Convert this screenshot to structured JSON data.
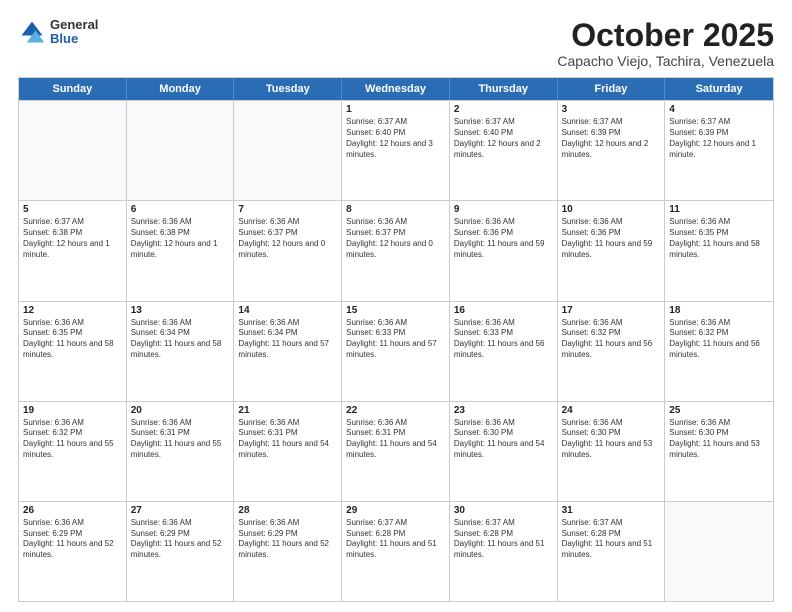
{
  "header": {
    "logo": {
      "line1": "General",
      "line2": "Blue"
    },
    "title": "October 2025",
    "subtitle": "Capacho Viejo, Tachira, Venezuela"
  },
  "calendar": {
    "days": [
      "Sunday",
      "Monday",
      "Tuesday",
      "Wednesday",
      "Thursday",
      "Friday",
      "Saturday"
    ],
    "rows": [
      [
        {
          "day": "",
          "info": "",
          "empty": true
        },
        {
          "day": "",
          "info": "",
          "empty": true
        },
        {
          "day": "",
          "info": "",
          "empty": true
        },
        {
          "day": "1",
          "info": "Sunrise: 6:37 AM\nSunset: 6:40 PM\nDaylight: 12 hours and 3 minutes.",
          "empty": false
        },
        {
          "day": "2",
          "info": "Sunrise: 6:37 AM\nSunset: 6:40 PM\nDaylight: 12 hours and 2 minutes.",
          "empty": false
        },
        {
          "day": "3",
          "info": "Sunrise: 6:37 AM\nSunset: 6:39 PM\nDaylight: 12 hours and 2 minutes.",
          "empty": false
        },
        {
          "day": "4",
          "info": "Sunrise: 6:37 AM\nSunset: 6:39 PM\nDaylight: 12 hours and 1 minute.",
          "empty": false
        }
      ],
      [
        {
          "day": "5",
          "info": "Sunrise: 6:37 AM\nSunset: 6:38 PM\nDaylight: 12 hours and 1 minute.",
          "empty": false
        },
        {
          "day": "6",
          "info": "Sunrise: 6:36 AM\nSunset: 6:38 PM\nDaylight: 12 hours and 1 minute.",
          "empty": false
        },
        {
          "day": "7",
          "info": "Sunrise: 6:36 AM\nSunset: 6:37 PM\nDaylight: 12 hours and 0 minutes.",
          "empty": false
        },
        {
          "day": "8",
          "info": "Sunrise: 6:36 AM\nSunset: 6:37 PM\nDaylight: 12 hours and 0 minutes.",
          "empty": false
        },
        {
          "day": "9",
          "info": "Sunrise: 6:36 AM\nSunset: 6:36 PM\nDaylight: 11 hours and 59 minutes.",
          "empty": false
        },
        {
          "day": "10",
          "info": "Sunrise: 6:36 AM\nSunset: 6:36 PM\nDaylight: 11 hours and 59 minutes.",
          "empty": false
        },
        {
          "day": "11",
          "info": "Sunrise: 6:36 AM\nSunset: 6:35 PM\nDaylight: 11 hours and 58 minutes.",
          "empty": false
        }
      ],
      [
        {
          "day": "12",
          "info": "Sunrise: 6:36 AM\nSunset: 6:35 PM\nDaylight: 11 hours and 58 minutes.",
          "empty": false
        },
        {
          "day": "13",
          "info": "Sunrise: 6:36 AM\nSunset: 6:34 PM\nDaylight: 11 hours and 58 minutes.",
          "empty": false
        },
        {
          "day": "14",
          "info": "Sunrise: 6:36 AM\nSunset: 6:34 PM\nDaylight: 11 hours and 57 minutes.",
          "empty": false
        },
        {
          "day": "15",
          "info": "Sunrise: 6:36 AM\nSunset: 6:33 PM\nDaylight: 11 hours and 57 minutes.",
          "empty": false
        },
        {
          "day": "16",
          "info": "Sunrise: 6:36 AM\nSunset: 6:33 PM\nDaylight: 11 hours and 56 minutes.",
          "empty": false
        },
        {
          "day": "17",
          "info": "Sunrise: 6:36 AM\nSunset: 6:32 PM\nDaylight: 11 hours and 56 minutes.",
          "empty": false
        },
        {
          "day": "18",
          "info": "Sunrise: 6:36 AM\nSunset: 6:32 PM\nDaylight: 11 hours and 56 minutes.",
          "empty": false
        }
      ],
      [
        {
          "day": "19",
          "info": "Sunrise: 6:36 AM\nSunset: 6:32 PM\nDaylight: 11 hours and 55 minutes.",
          "empty": false
        },
        {
          "day": "20",
          "info": "Sunrise: 6:36 AM\nSunset: 6:31 PM\nDaylight: 11 hours and 55 minutes.",
          "empty": false
        },
        {
          "day": "21",
          "info": "Sunrise: 6:36 AM\nSunset: 6:31 PM\nDaylight: 11 hours and 54 minutes.",
          "empty": false
        },
        {
          "day": "22",
          "info": "Sunrise: 6:36 AM\nSunset: 6:31 PM\nDaylight: 11 hours and 54 minutes.",
          "empty": false
        },
        {
          "day": "23",
          "info": "Sunrise: 6:36 AM\nSunset: 6:30 PM\nDaylight: 11 hours and 54 minutes.",
          "empty": false
        },
        {
          "day": "24",
          "info": "Sunrise: 6:36 AM\nSunset: 6:30 PM\nDaylight: 11 hours and 53 minutes.",
          "empty": false
        },
        {
          "day": "25",
          "info": "Sunrise: 6:36 AM\nSunset: 6:30 PM\nDaylight: 11 hours and 53 minutes.",
          "empty": false
        }
      ],
      [
        {
          "day": "26",
          "info": "Sunrise: 6:36 AM\nSunset: 6:29 PM\nDaylight: 11 hours and 52 minutes.",
          "empty": false
        },
        {
          "day": "27",
          "info": "Sunrise: 6:36 AM\nSunset: 6:29 PM\nDaylight: 11 hours and 52 minutes.",
          "empty": false
        },
        {
          "day": "28",
          "info": "Sunrise: 6:36 AM\nSunset: 6:29 PM\nDaylight: 11 hours and 52 minutes.",
          "empty": false
        },
        {
          "day": "29",
          "info": "Sunrise: 6:37 AM\nSunset: 6:28 PM\nDaylight: 11 hours and 51 minutes.",
          "empty": false
        },
        {
          "day": "30",
          "info": "Sunrise: 6:37 AM\nSunset: 6:28 PM\nDaylight: 11 hours and 51 minutes.",
          "empty": false
        },
        {
          "day": "31",
          "info": "Sunrise: 6:37 AM\nSunset: 6:28 PM\nDaylight: 11 hours and 51 minutes.",
          "empty": false
        },
        {
          "day": "",
          "info": "",
          "empty": true
        }
      ]
    ]
  }
}
